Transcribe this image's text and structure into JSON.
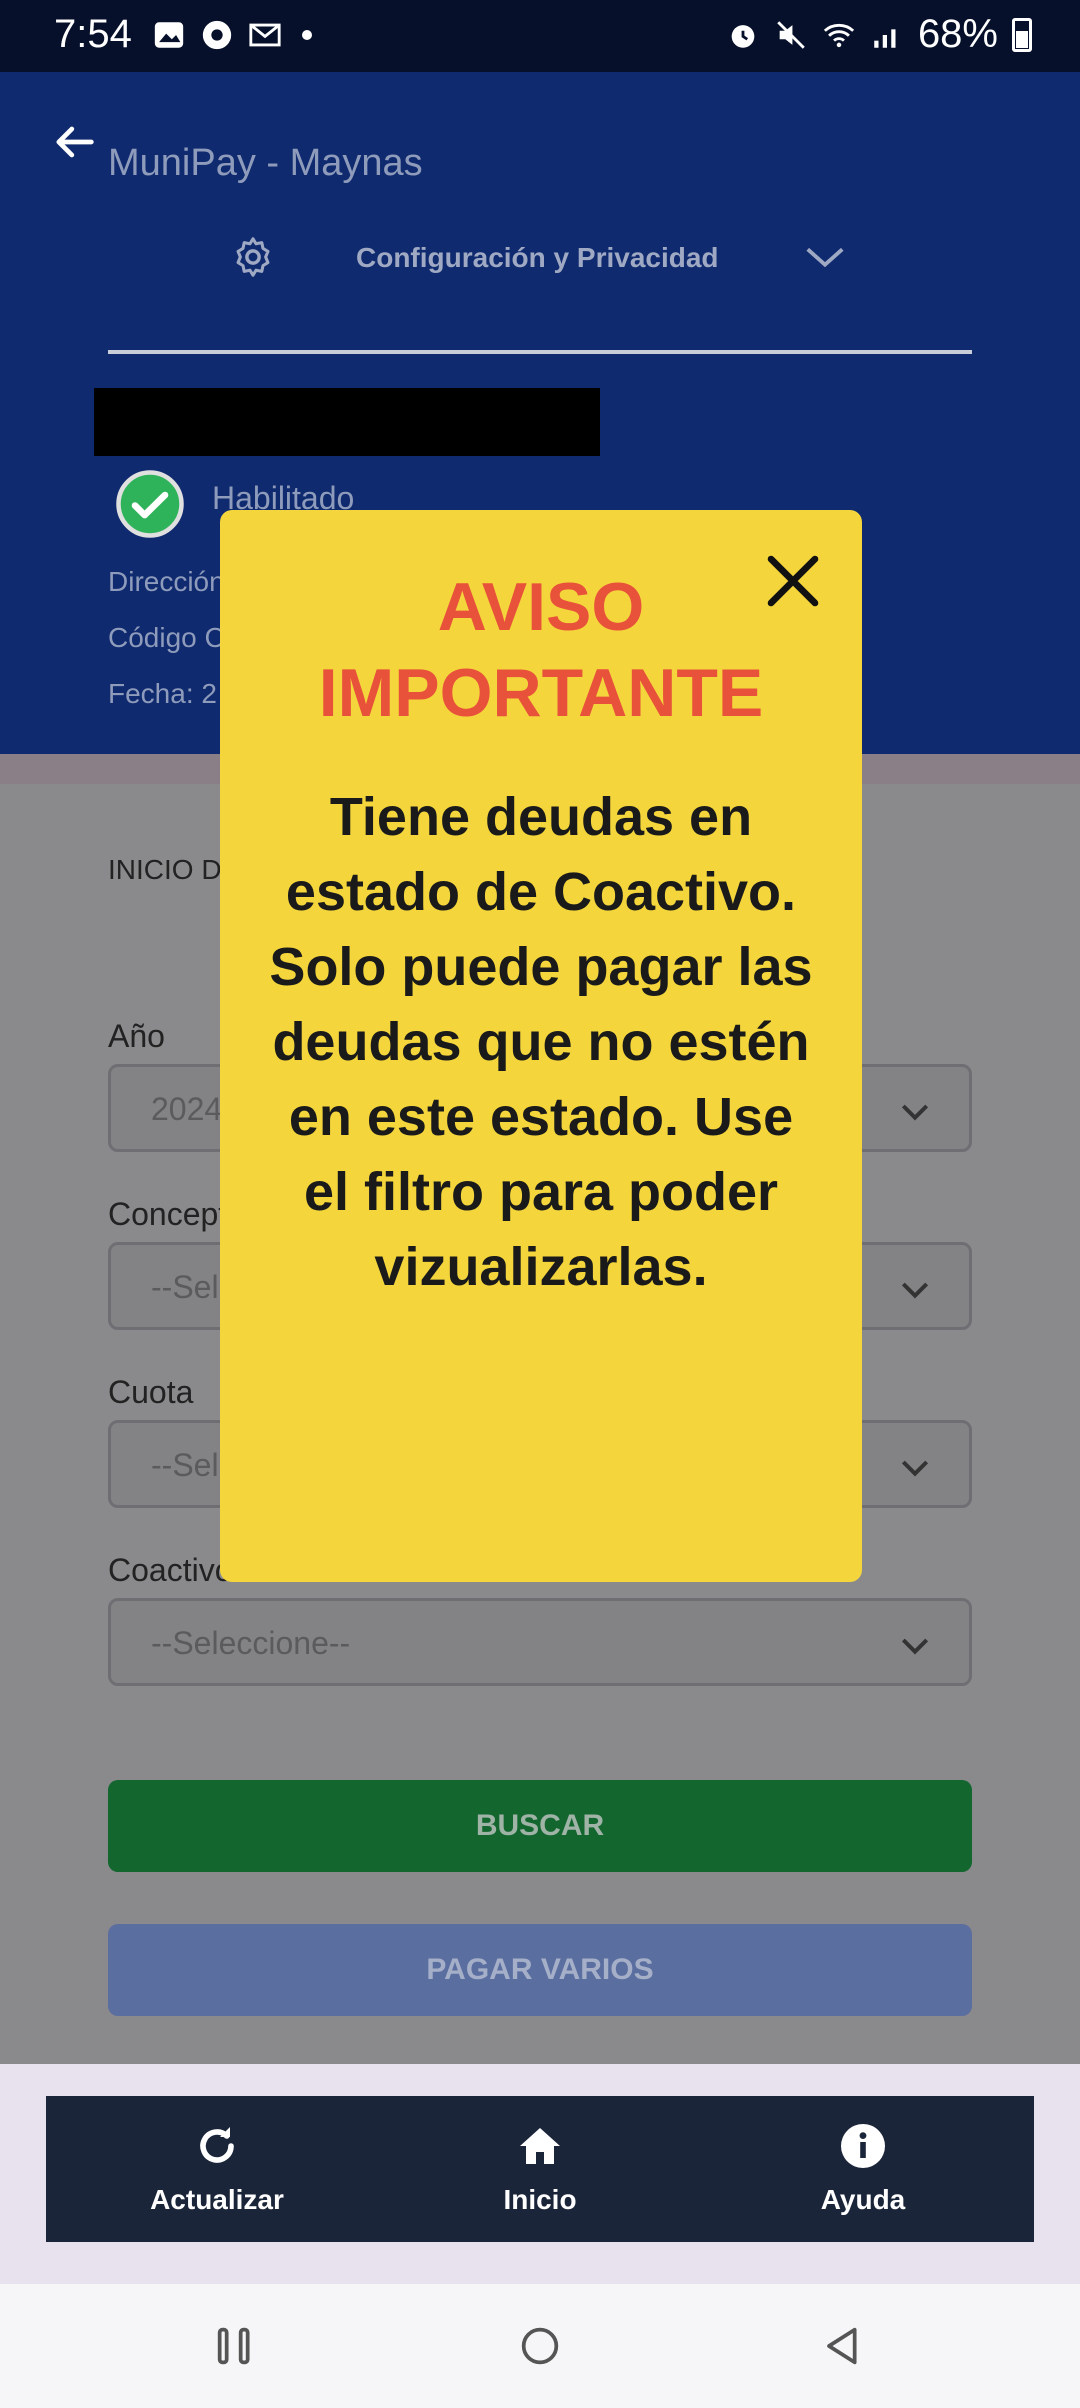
{
  "status_bar": {
    "time": "7:54",
    "battery_percent": "68%"
  },
  "header": {
    "app_title": "MuniPay - Maynas",
    "settings_label": "Configuración y Privacidad",
    "status_label": "Habilitado",
    "info_lines": [
      "Dirección:",
      "Código Contribuyente:",
      "Fecha: 2"
    ]
  },
  "form": {
    "section_title": "INICIO DE CONSULTA",
    "fields": [
      {
        "label": "Año",
        "value": "2024"
      },
      {
        "label": "Concepto",
        "value": "--Seleccione--"
      },
      {
        "label": "Cuota",
        "value": "--Seleccione--"
      },
      {
        "label": "Coactivo",
        "value": "--Seleccione--"
      }
    ],
    "search_button": "BUSCAR",
    "pay_multiple_button": "PAGAR VARIOS"
  },
  "bottom_nav": {
    "items": [
      {
        "label": "Actualizar",
        "icon": "refresh-icon"
      },
      {
        "label": "Inicio",
        "icon": "home-icon"
      },
      {
        "label": "Ayuda",
        "icon": "info-icon"
      }
    ]
  },
  "modal": {
    "title": "AVISO IMPORTANTE",
    "message": "Tiene deudas en estado de Coactivo. Solo puede pagar las deudas que no estén en este estado. Use el filtro para poder vizualizarlas."
  },
  "colors": {
    "header_bg": "#0f2a6e",
    "modal_bg": "#f4d63c",
    "modal_title": "#e8513a",
    "search_button": "#12662e",
    "pay_button": "#5a6ea0",
    "bottom_nav_bg": "#1b253a"
  }
}
